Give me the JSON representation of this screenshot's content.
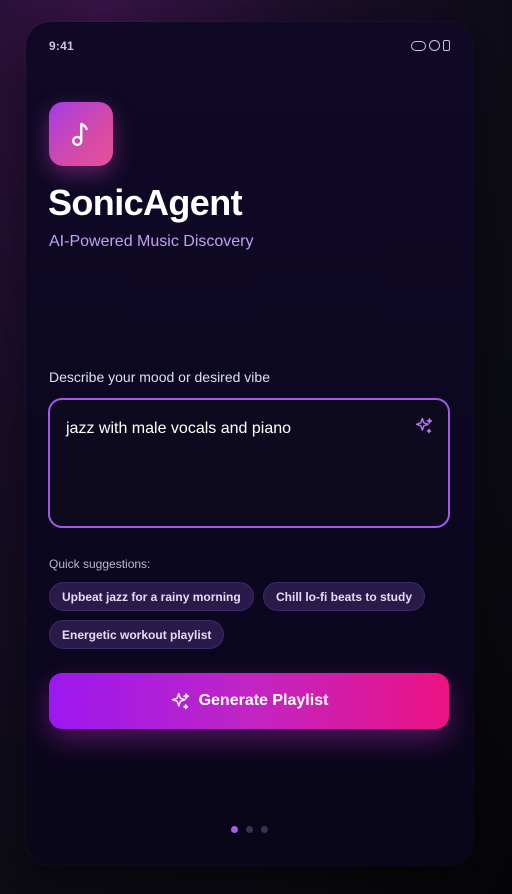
{
  "status_bar": {
    "time": "9:41"
  },
  "header": {
    "app_icon": "music-note-icon",
    "title": "SonicAgent",
    "subtitle": "AI-Powered Music Discovery"
  },
  "mood_input": {
    "label": "Describe your mood or desired vibe",
    "value": "jazz with male vocals and piano",
    "icon": "sparkle-icon"
  },
  "suggestions": {
    "label": "Quick suggestions:",
    "items": [
      "Upbeat jazz for a rainy morning",
      "Chill lo-fi beats to study",
      "Energetic workout playlist"
    ]
  },
  "generate_button": {
    "label": "Generate Playlist",
    "icon": "sparkle-icon"
  },
  "pagination": {
    "total": 3,
    "active": 1
  },
  "colors": {
    "accent_purple": "#a259e8",
    "gradient_start": "#9c18f0",
    "gradient_end": "#ec1283",
    "subtitle": "#c79ef5",
    "chip_bg": "#2a1a4a"
  }
}
